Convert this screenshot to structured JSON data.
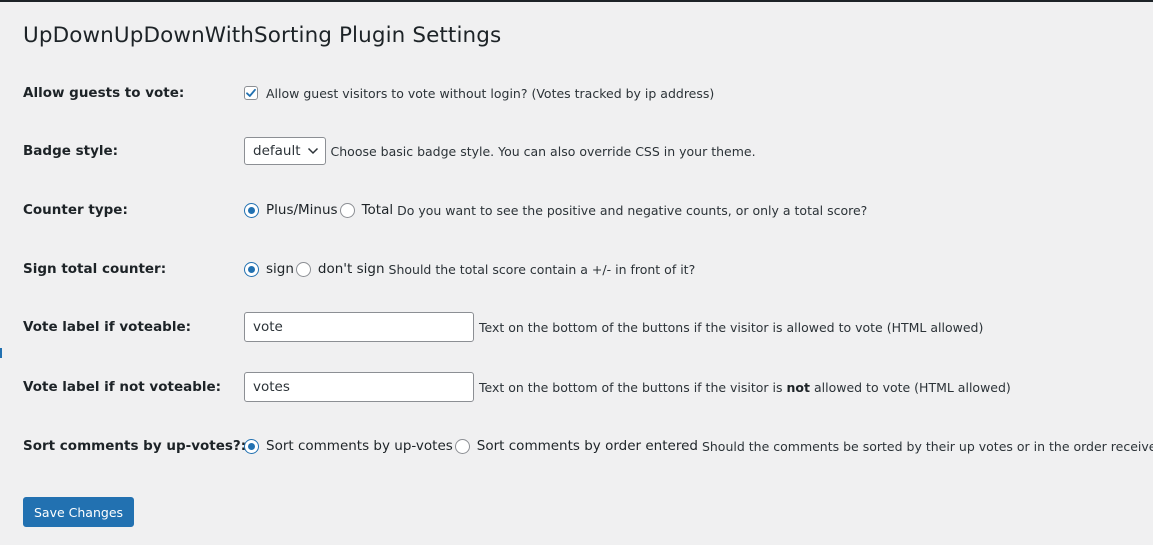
{
  "page": {
    "title": "UpDownUpDownWithSorting Plugin Settings"
  },
  "settings": {
    "allow_guests": {
      "label": "Allow guests to vote:",
      "checkbox_label": "Allow guest visitors to vote without login? (Votes tracked by ip address)",
      "checked": true
    },
    "badge_style": {
      "label": "Badge style:",
      "selected": "default",
      "description": "Choose basic badge style. You can also override CSS in your theme."
    },
    "counter_type": {
      "label": "Counter type:",
      "option_1": "Plus/Minus",
      "option_2": "Total",
      "selected": "Plus/Minus",
      "description": "Do you want to see the positive and negative counts, or only a total score?"
    },
    "sign_total": {
      "label": "Sign total counter:",
      "option_1": "sign",
      "option_2": "don't sign",
      "selected": "sign",
      "description": "Should the total score contain a +/- in front of it?"
    },
    "vote_label_voteable": {
      "label": "Vote label if voteable:",
      "value": "vote",
      "description": "Text on the bottom of the buttons if the visitor is allowed to vote (HTML allowed)"
    },
    "vote_label_not_voteable": {
      "label": "Vote label if not voteable:",
      "value": "votes",
      "description_pre": "Text on the bottom of the buttons if the visitor is",
      "description_bold": "not",
      "description_post": "allowed to vote (HTML allowed)"
    },
    "sort_comments": {
      "label": "Sort comments by up-votes?:",
      "option_1": "Sort comments by up-votes",
      "option_2": "Sort comments by order entered",
      "selected": "Sort comments by up-votes",
      "description": "Should the comments be sorted by their up votes or in the order received?"
    }
  },
  "actions": {
    "save_label": "Save Changes"
  },
  "colors": {
    "accent": "#2271b1",
    "background": "#f0f0f1",
    "text": "#1d2327"
  }
}
